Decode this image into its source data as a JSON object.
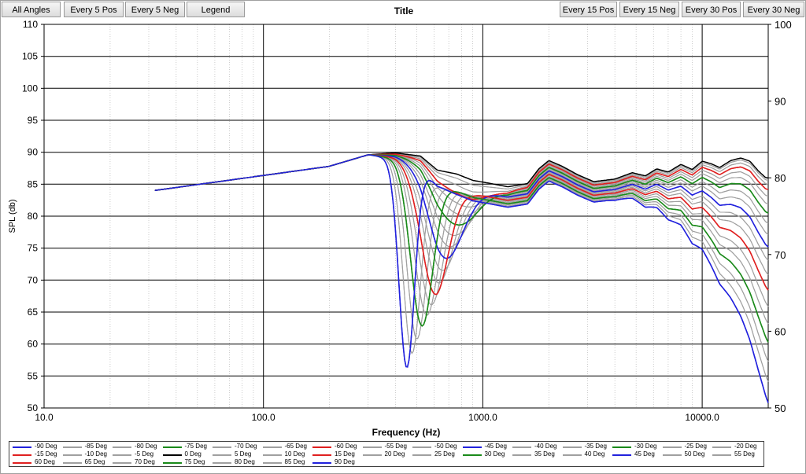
{
  "buttons": {
    "all_angles": "All Angles",
    "every5pos": "Every 5 Pos",
    "every5neg": "Every 5 Neg",
    "legend": "Legend",
    "every15pos": "Every 15 Pos",
    "every15neg": "Every 15 Neg",
    "every30pos": "Every 30 Pos",
    "every30neg": "Every 30 Neg"
  },
  "chart_data": {
    "type": "line",
    "title": "Title",
    "xlabel": "Frequency (Hz)",
    "ylabel": "SPL (db)",
    "xscale": "log",
    "xlim": [
      10,
      20000
    ],
    "ylim": [
      50,
      110
    ],
    "y2lim": [
      50,
      100
    ],
    "grid": true,
    "legend_position": "bottom",
    "x_ticks": [
      "10.0",
      "100.0",
      "1000.0",
      "10000.0"
    ],
    "y_ticks": [
      "50",
      "55",
      "60",
      "65",
      "70",
      "75",
      "80",
      "85",
      "90",
      "95",
      "100",
      "105",
      "110"
    ],
    "y2_ticks": [
      "50",
      "60",
      "70",
      "80",
      "90",
      "100"
    ],
    "series": [
      {
        "name": "-90 Deg",
        "color": "#2222dd",
        "angle": 90
      },
      {
        "name": "-85 Deg",
        "color": "#a0a0a0",
        "angle": 85
      },
      {
        "name": "-80 Deg",
        "color": "#a0a0a0",
        "angle": 80
      },
      {
        "name": "-75 Deg",
        "color": "#1a8a1a",
        "angle": 75
      },
      {
        "name": "-70 Deg",
        "color": "#a0a0a0",
        "angle": 70
      },
      {
        "name": "-65 Deg",
        "color": "#a0a0a0",
        "angle": 65
      },
      {
        "name": "-60 Deg",
        "color": "#e02020",
        "angle": 60
      },
      {
        "name": "-55 Deg",
        "color": "#a0a0a0",
        "angle": 55
      },
      {
        "name": "-50 Deg",
        "color": "#a0a0a0",
        "angle": 50
      },
      {
        "name": "-45 Deg",
        "color": "#2222dd",
        "angle": 45
      },
      {
        "name": "-40 Deg",
        "color": "#a0a0a0",
        "angle": 40
      },
      {
        "name": "-35 Deg",
        "color": "#a0a0a0",
        "angle": 35
      },
      {
        "name": "-30 Deg",
        "color": "#1a8a1a",
        "angle": 30
      },
      {
        "name": "-25 Deg",
        "color": "#a0a0a0",
        "angle": 25
      },
      {
        "name": "-20 Deg",
        "color": "#a0a0a0",
        "angle": 20
      },
      {
        "name": "-15 Deg",
        "color": "#e02020",
        "angle": 15
      },
      {
        "name": "-10 Deg",
        "color": "#a0a0a0",
        "angle": 10
      },
      {
        "name": "-5 Deg",
        "color": "#a0a0a0",
        "angle": 5
      },
      {
        "name": "0 Deg",
        "color": "#000000",
        "angle": 0
      },
      {
        "name": "5 Deg",
        "color": "#a0a0a0",
        "angle": 5
      },
      {
        "name": "10 Deg",
        "color": "#a0a0a0",
        "angle": 10
      },
      {
        "name": "15 Deg",
        "color": "#e02020",
        "angle": 15
      },
      {
        "name": "20 Deg",
        "color": "#a0a0a0",
        "angle": 20
      },
      {
        "name": "25 Deg",
        "color": "#a0a0a0",
        "angle": 25
      },
      {
        "name": "30 Deg",
        "color": "#1a8a1a",
        "angle": 30
      },
      {
        "name": "35 Deg",
        "color": "#a0a0a0",
        "angle": 35
      },
      {
        "name": "40 Deg",
        "color": "#a0a0a0",
        "angle": 40
      },
      {
        "name": "45 Deg",
        "color": "#2222dd",
        "angle": 45
      },
      {
        "name": "50 Deg",
        "color": "#a0a0a0",
        "angle": 50
      },
      {
        "name": "55 Deg",
        "color": "#a0a0a0",
        "angle": 55
      },
      {
        "name": "60 Deg",
        "color": "#e02020",
        "angle": 60
      },
      {
        "name": "65 Deg",
        "color": "#a0a0a0",
        "angle": 65
      },
      {
        "name": "70 Deg",
        "color": "#a0a0a0",
        "angle": 70
      },
      {
        "name": "75 Deg",
        "color": "#1a8a1a",
        "angle": 75
      },
      {
        "name": "80 Deg",
        "color": "#a0a0a0",
        "angle": 80
      },
      {
        "name": "85 Deg",
        "color": "#a0a0a0",
        "angle": 85
      },
      {
        "name": "90 Deg",
        "color": "#2222dd",
        "angle": 90
      }
    ]
  }
}
